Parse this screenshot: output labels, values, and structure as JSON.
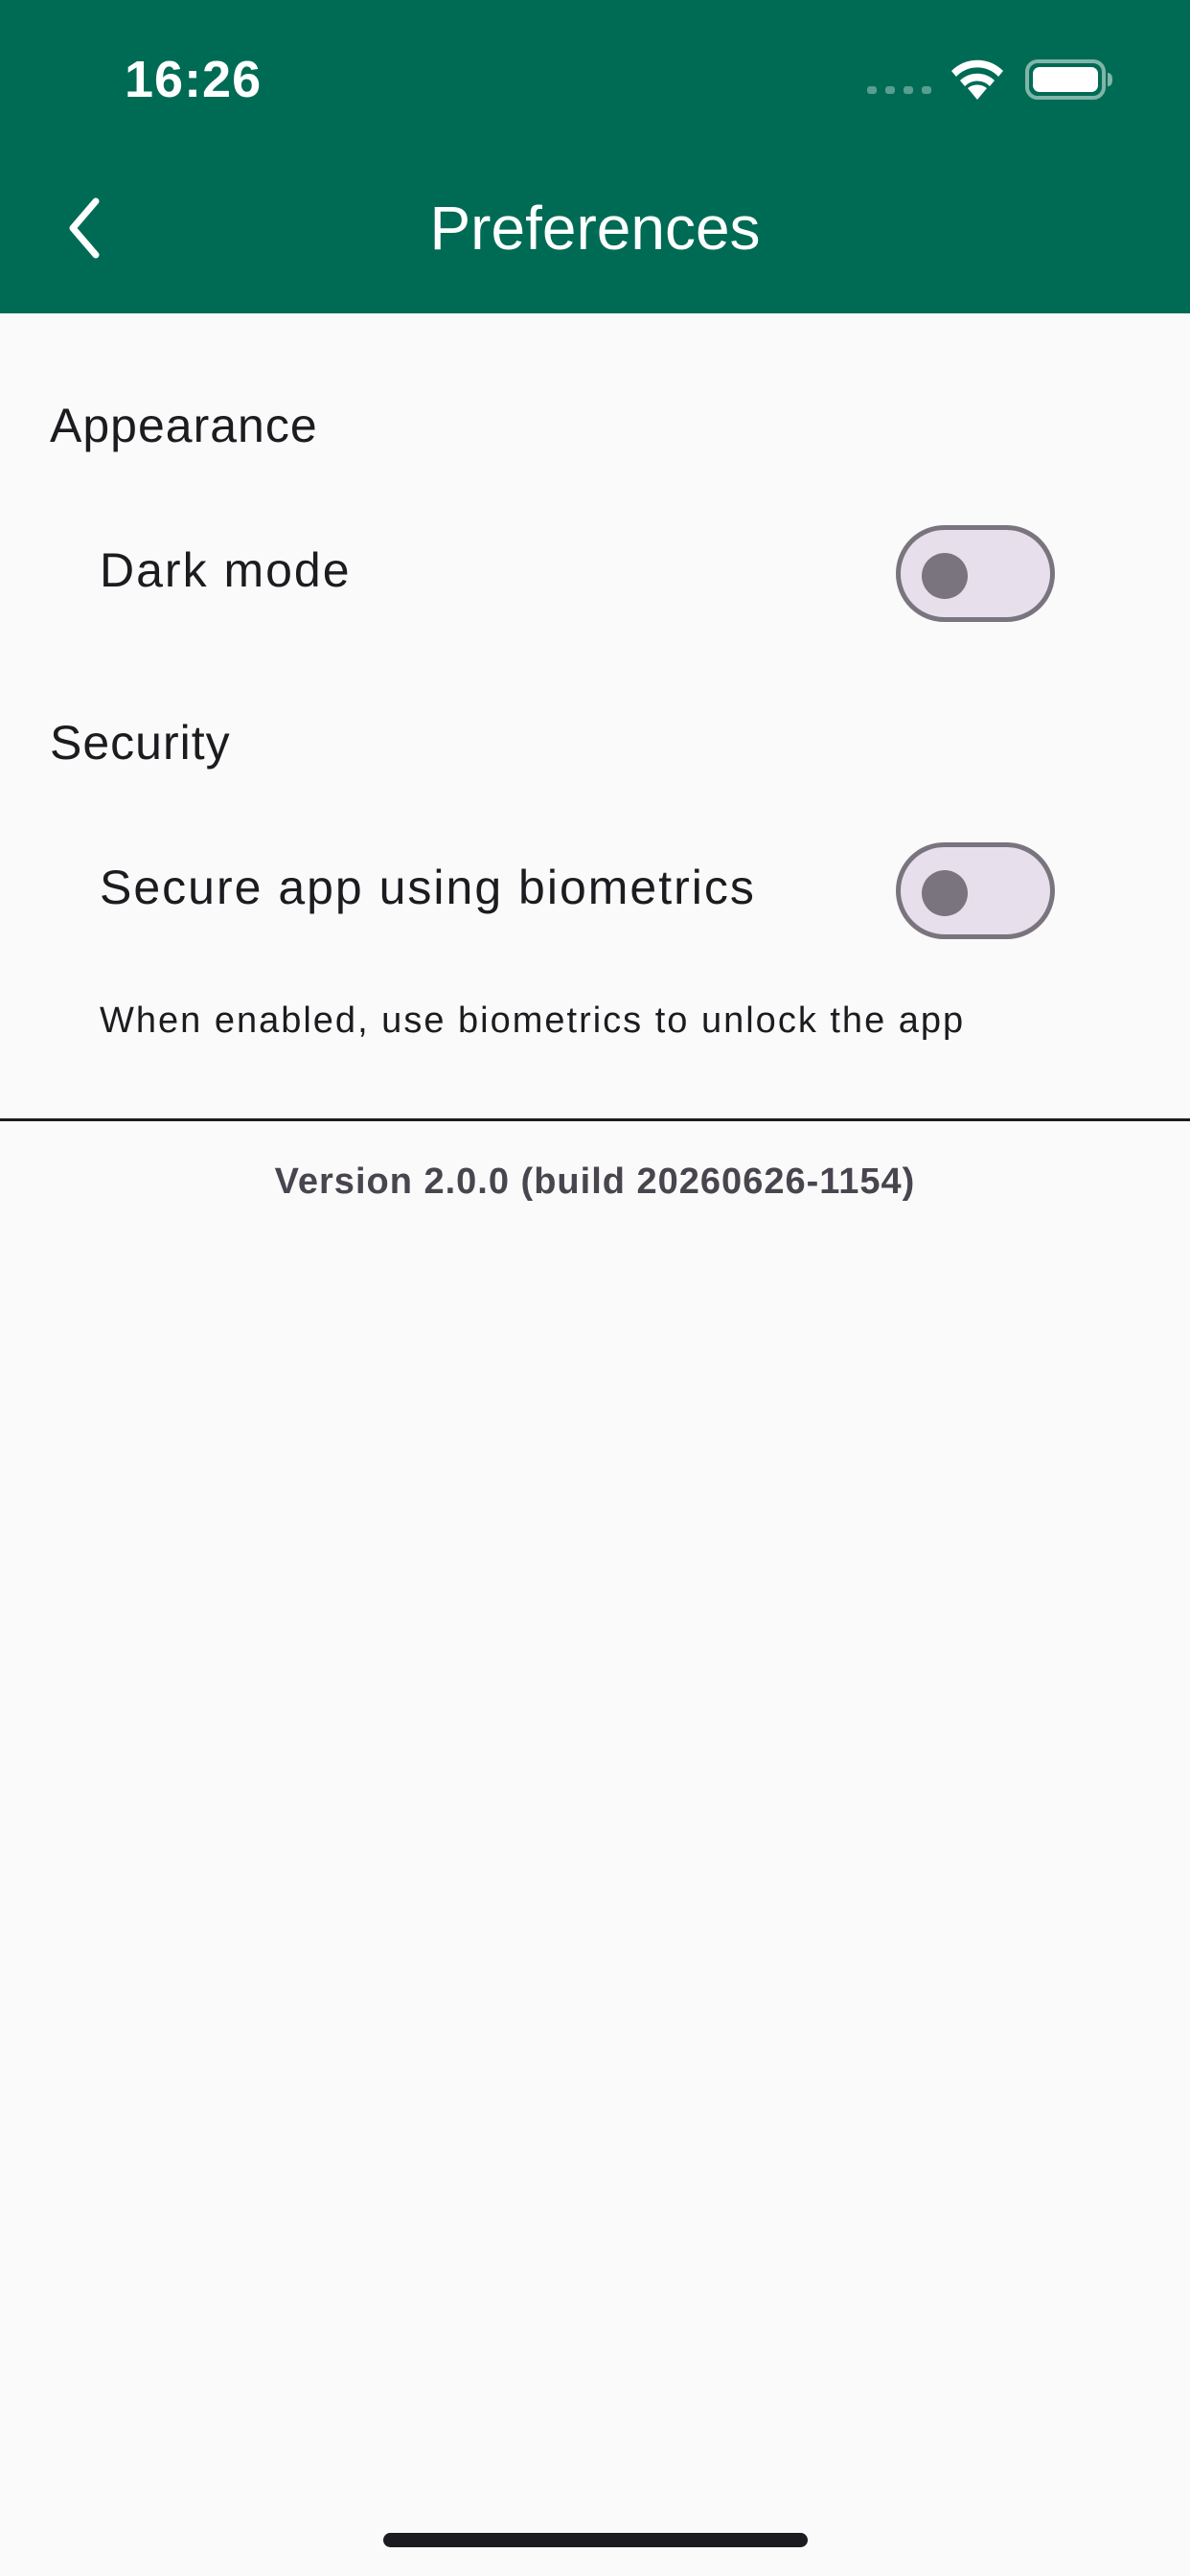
{
  "status_bar": {
    "time": "16:26",
    "icons": [
      "signal-icon",
      "wifi-icon",
      "battery-icon"
    ]
  },
  "app_bar": {
    "title": "Preferences",
    "back_icon": "chevron-left-icon",
    "background_color": "#006b54"
  },
  "sections": [
    {
      "header": "Appearance",
      "settings": [
        {
          "label": "Dark mode",
          "enabled": false
        }
      ]
    },
    {
      "header": "Security",
      "settings": [
        {
          "label": "Secure app using biometrics",
          "enabled": false,
          "description": "When enabled, use biometrics to unlock the app"
        }
      ]
    }
  ],
  "footer": {
    "version": "Version 2.0.0 (build 20260626-1154)"
  },
  "colors": {
    "accent": "#006b54",
    "surface": "#fafafa",
    "switch_track": "#e7e0ec",
    "switch_outline": "#79747e"
  }
}
